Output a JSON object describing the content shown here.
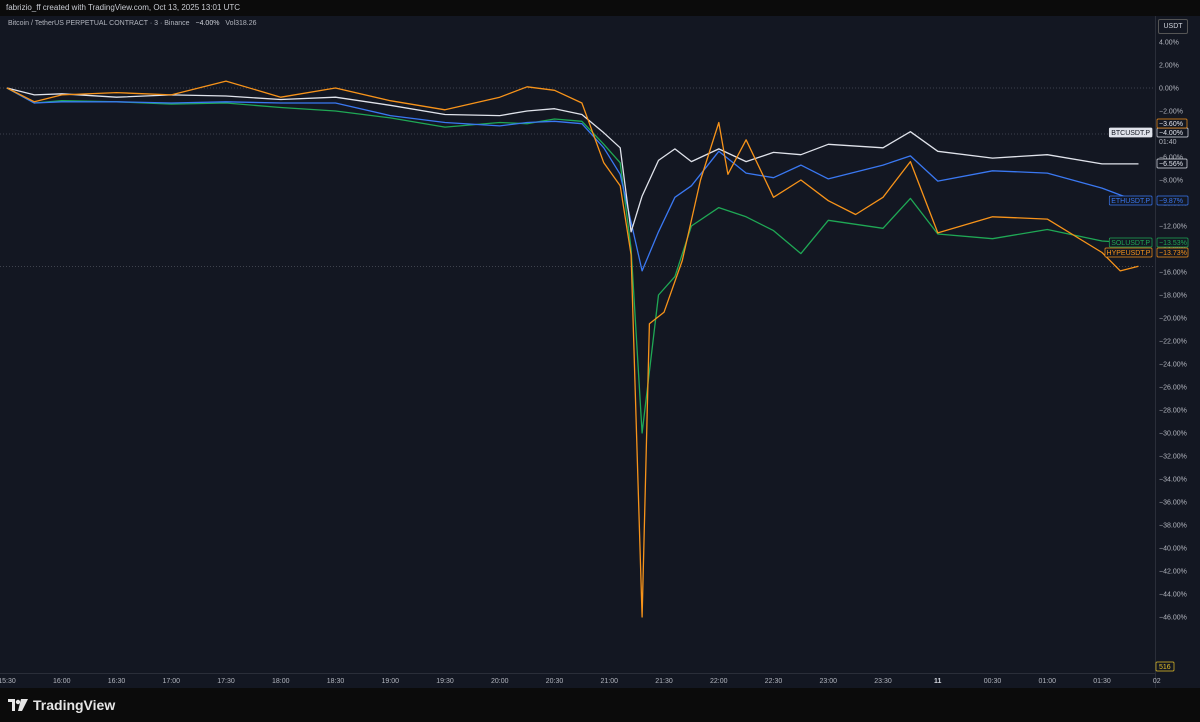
{
  "header": {
    "credit": "fabrizio_ff created with TradingView.com, Oct 13, 2025 13:01 UTC"
  },
  "legend": {
    "symbol": "Bitcoin / TetherUS PERPETUAL CONTRACT · 3 · Binance",
    "change": "−4.00%",
    "volume": "Vol318.26"
  },
  "axis": {
    "currency": "USDT",
    "bottom_badge": "516"
  },
  "footer": {
    "brand": "TradingView"
  },
  "colors": {
    "background": "#131722",
    "btc": "#e0e3eb",
    "eth": "#3a78f2",
    "sol": "#1fa855",
    "hype": "#f7931a"
  },
  "chart_data": {
    "type": "line",
    "title": "",
    "xlabel": "",
    "ylabel": "",
    "y_unit": "%",
    "ylim": [
      -48,
      5.5
    ],
    "grid": false,
    "x_ticks": [
      "15:30",
      "16:00",
      "16:30",
      "17:00",
      "17:30",
      "18:00",
      "18:30",
      "19:00",
      "19:30",
      "20:00",
      "20:30",
      "21:00",
      "21:30",
      "22:00",
      "22:30",
      "23:00",
      "23:30",
      "11",
      "00:30",
      "01:00",
      "01:30",
      "02"
    ],
    "y_ticks": [
      "4.00%",
      "2.00%",
      "0.00%",
      "−2.00%",
      "−4.00%",
      "−6.00%",
      "−8.00%",
      "−10.00%",
      "−12.00%",
      "−14.00%",
      "−16.00%",
      "−18.00%",
      "−20.00%",
      "−22.00%",
      "−24.00%",
      "−26.00%",
      "−28.00%",
      "−30.00%",
      "−32.00%",
      "−34.00%",
      "−36.00%",
      "−38.00%",
      "−40.00%",
      "−42.00%",
      "−44.00%",
      "−46.00%"
    ],
    "series": [
      {
        "name": "BTCUSDT.P",
        "color": "#e0e3eb",
        "last_label": "−4.00%",
        "sub_label": "01:40",
        "points": [
          [
            "15:30",
            0
          ],
          [
            "15:45",
            -0.6
          ],
          [
            "16:00",
            -0.5
          ],
          [
            "16:30",
            -0.8
          ],
          [
            "17:00",
            -0.6
          ],
          [
            "17:30",
            -0.7
          ],
          [
            "18:00",
            -1.0
          ],
          [
            "18:30",
            -0.8
          ],
          [
            "19:00",
            -1.5
          ],
          [
            "19:30",
            -2.3
          ],
          [
            "20:00",
            -2.4
          ],
          [
            "20:15",
            -2.0
          ],
          [
            "20:30",
            -1.8
          ],
          [
            "20:45",
            -2.3
          ],
          [
            "20:57",
            -3.9
          ],
          [
            "21:06",
            -5.2
          ],
          [
            "21:12",
            -12.5
          ],
          [
            "21:18",
            -9.4
          ],
          [
            "21:27",
            -6.3
          ],
          [
            "21:36",
            -5.3
          ],
          [
            "21:45",
            -6.4
          ],
          [
            "22:00",
            -5.3
          ],
          [
            "22:15",
            -6.4
          ],
          [
            "22:30",
            -5.6
          ],
          [
            "22:45",
            -5.8
          ],
          [
            "23:00",
            -4.9
          ],
          [
            "23:30",
            -5.2
          ],
          [
            "23:45",
            -3.8
          ],
          [
            "00:00",
            -5.5
          ],
          [
            "00:30",
            -6.1
          ],
          [
            "01:00",
            -5.8
          ],
          [
            "01:30",
            -6.6
          ],
          [
            "01:50",
            -6.6
          ]
        ]
      },
      {
        "name": "ETHUSDT.P",
        "color": "#3a78f2",
        "last_label": "−9.87%",
        "points": [
          [
            "15:30",
            0
          ],
          [
            "15:45",
            -1.3
          ],
          [
            "16:00",
            -1.2
          ],
          [
            "16:30",
            -1.2
          ],
          [
            "17:00",
            -1.3
          ],
          [
            "17:30",
            -1.2
          ],
          [
            "18:00",
            -1.3
          ],
          [
            "18:30",
            -1.3
          ],
          [
            "19:00",
            -2.4
          ],
          [
            "19:30",
            -3.0
          ],
          [
            "20:00",
            -3.3
          ],
          [
            "20:15",
            -3.0
          ],
          [
            "20:30",
            -2.9
          ],
          [
            "20:45",
            -3.1
          ],
          [
            "20:57",
            -5.2
          ],
          [
            "21:06",
            -7.5
          ],
          [
            "21:18",
            -15.9
          ],
          [
            "21:27",
            -12.5
          ],
          [
            "21:36",
            -9.5
          ],
          [
            "21:45",
            -8.5
          ],
          [
            "22:00",
            -5.5
          ],
          [
            "22:15",
            -7.4
          ],
          [
            "22:30",
            -7.8
          ],
          [
            "22:45",
            -6.7
          ],
          [
            "23:00",
            -7.9
          ],
          [
            "23:30",
            -6.7
          ],
          [
            "23:45",
            -5.9
          ],
          [
            "00:00",
            -8.1
          ],
          [
            "00:30",
            -7.2
          ],
          [
            "01:00",
            -7.4
          ],
          [
            "01:30",
            -8.7
          ],
          [
            "01:50",
            -9.9
          ]
        ]
      },
      {
        "name": "SOLUSDT.P",
        "color": "#1fa855",
        "last_label": "−13.53%",
        "points": [
          [
            "15:30",
            0
          ],
          [
            "15:45",
            -1.3
          ],
          [
            "16:00",
            -1.1
          ],
          [
            "16:30",
            -1.2
          ],
          [
            "17:00",
            -1.4
          ],
          [
            "17:30",
            -1.3
          ],
          [
            "18:00",
            -1.7
          ],
          [
            "18:30",
            -2.0
          ],
          [
            "19:00",
            -2.6
          ],
          [
            "19:30",
            -3.4
          ],
          [
            "20:00",
            -3.0
          ],
          [
            "20:15",
            -3.1
          ],
          [
            "20:30",
            -2.7
          ],
          [
            "20:45",
            -2.9
          ],
          [
            "20:57",
            -4.9
          ],
          [
            "21:06",
            -6.5
          ],
          [
            "21:12",
            -14.0
          ],
          [
            "21:18",
            -30.0
          ],
          [
            "21:27",
            -18.0
          ],
          [
            "21:36",
            -16.4
          ],
          [
            "21:45",
            -12.0
          ],
          [
            "22:00",
            -10.4
          ],
          [
            "22:15",
            -11.2
          ],
          [
            "22:30",
            -12.4
          ],
          [
            "22:45",
            -14.4
          ],
          [
            "23:00",
            -11.5
          ],
          [
            "23:30",
            -12.2
          ],
          [
            "23:45",
            -9.6
          ],
          [
            "00:00",
            -12.7
          ],
          [
            "00:30",
            -13.1
          ],
          [
            "01:00",
            -12.3
          ],
          [
            "01:30",
            -13.3
          ],
          [
            "01:50",
            -13.5
          ]
        ]
      },
      {
        "name": "HYPEUSDT.P",
        "color": "#f7931a",
        "last_label": "−13.73%",
        "points": [
          [
            "15:30",
            0
          ],
          [
            "15:45",
            -1.2
          ],
          [
            "16:00",
            -0.6
          ],
          [
            "16:30",
            -0.4
          ],
          [
            "17:00",
            -0.6
          ],
          [
            "17:30",
            0.6
          ],
          [
            "18:00",
            -0.8
          ],
          [
            "18:30",
            0.0
          ],
          [
            "19:00",
            -1.1
          ],
          [
            "19:30",
            -1.9
          ],
          [
            "20:00",
            -0.8
          ],
          [
            "20:15",
            0.1
          ],
          [
            "20:30",
            -0.2
          ],
          [
            "20:45",
            -1.3
          ],
          [
            "20:57",
            -6.5
          ],
          [
            "21:06",
            -8.5
          ],
          [
            "21:12",
            -14.5
          ],
          [
            "21:18",
            -46.0
          ],
          [
            "21:22",
            -20.5
          ],
          [
            "21:30",
            -19.5
          ],
          [
            "21:40",
            -15.0
          ],
          [
            "21:50",
            -8.0
          ],
          [
            "22:00",
            -3.0
          ],
          [
            "22:05",
            -7.5
          ],
          [
            "22:15",
            -4.5
          ],
          [
            "22:30",
            -9.5
          ],
          [
            "22:45",
            -8.0
          ],
          [
            "23:00",
            -9.8
          ],
          [
            "23:15",
            -11.0
          ],
          [
            "23:30",
            -9.5
          ],
          [
            "23:45",
            -6.4
          ],
          [
            "00:00",
            -12.6
          ],
          [
            "00:30",
            -11.2
          ],
          [
            "01:00",
            -11.4
          ],
          [
            "01:30",
            -14.3
          ],
          [
            "01:40",
            -15.9
          ],
          [
            "01:50",
            -15.5
          ]
        ]
      }
    ]
  }
}
